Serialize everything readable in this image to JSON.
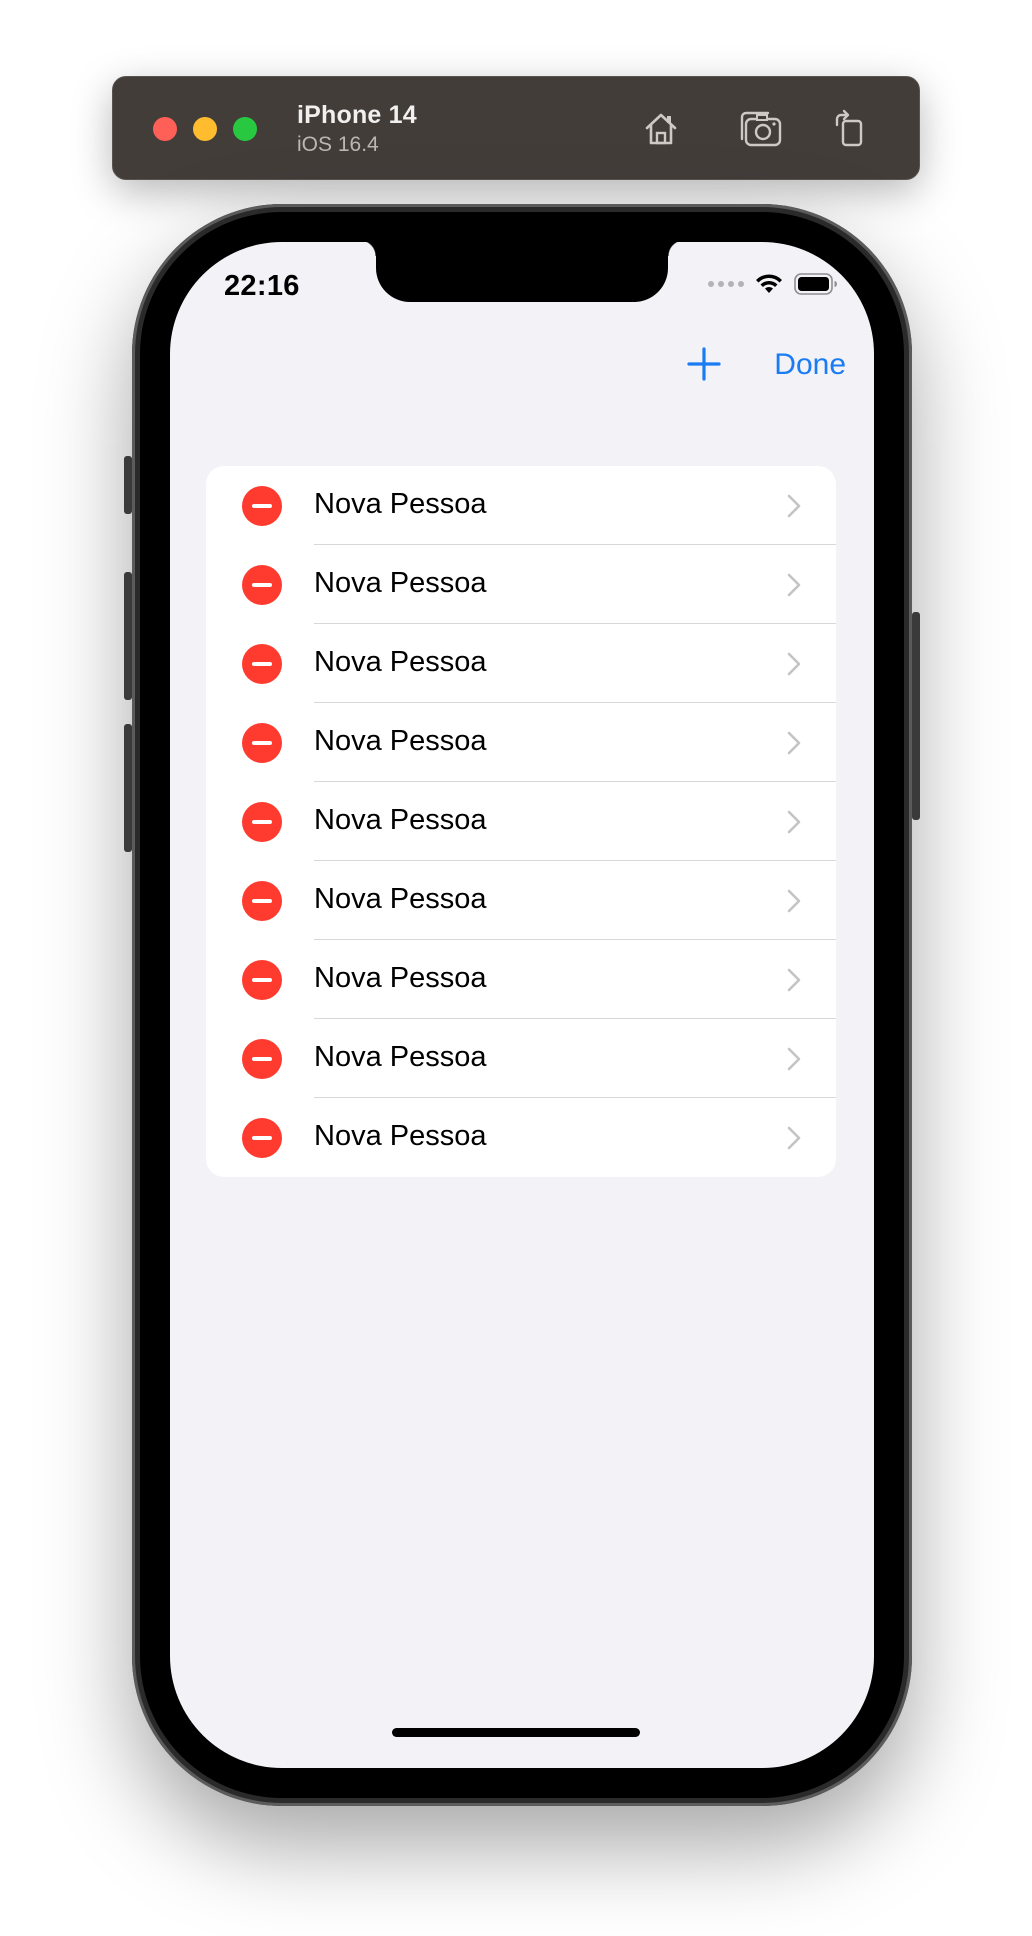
{
  "simulator": {
    "device_name": "iPhone 14",
    "os_version": "iOS 16.4",
    "icons": [
      "home-icon",
      "screenshot-icon",
      "rotate-icon"
    ]
  },
  "status_bar": {
    "time": "22:16",
    "icons": [
      "signal-dots-icon",
      "wifi-icon",
      "battery-icon"
    ]
  },
  "nav": {
    "add_icon": "plus-icon",
    "done_label": "Done"
  },
  "list": {
    "items": [
      {
        "label": "Nova Pessoa"
      },
      {
        "label": "Nova Pessoa"
      },
      {
        "label": "Nova Pessoa"
      },
      {
        "label": "Nova Pessoa"
      },
      {
        "label": "Nova Pessoa"
      },
      {
        "label": "Nova Pessoa"
      },
      {
        "label": "Nova Pessoa"
      },
      {
        "label": "Nova Pessoa"
      },
      {
        "label": "Nova Pessoa"
      }
    ]
  },
  "colors": {
    "accent": "#1a7cf3",
    "delete": "#ff3b30",
    "screen_background": "#f2f2f7"
  }
}
